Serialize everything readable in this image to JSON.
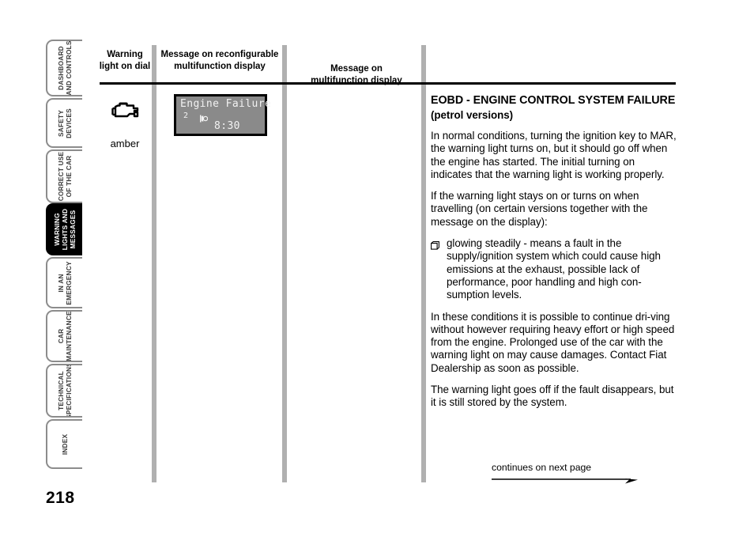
{
  "page": {
    "number": "218"
  },
  "sidebar": {
    "items": [
      {
        "label": "DASHBOARD\nAND CONTROLS",
        "active": false
      },
      {
        "label": "SAFETY\nDEVICES",
        "active": false
      },
      {
        "label": "CORRECT USE\nOF THE CAR",
        "active": false
      },
      {
        "label": "WARNING\nLIGHTS AND\nMESSAGES",
        "active": true
      },
      {
        "label": "IN AN\nEMERGENCY",
        "active": false
      },
      {
        "label": "CAR\nMAINTENANCE",
        "active": false
      },
      {
        "label": "TECHNICAL\nSPECIFICATIONS",
        "active": false
      },
      {
        "label": "INDEX",
        "active": false
      }
    ]
  },
  "table": {
    "headers": {
      "col1": "Warning\nlight on dial",
      "col2": "Message on reconfigurable\nmultifunction display",
      "col3": "Message on\nmultifunction display"
    },
    "warning_light": {
      "icon": "engine-check-icon",
      "color_label": "amber"
    },
    "lcd": {
      "message": "Engine Failure",
      "zone": "2",
      "zone_icon": "key-symbol",
      "time": "8:30",
      "background_color": "#8a8a8a",
      "text_color": "#f2f2f2"
    }
  },
  "content": {
    "title_main": "EOBD - ENGINE CONTROL SYSTEM FAILURE",
    "title_sub": " (petrol versions)",
    "paragraphs": [
      "In normal conditions, turning the ignition key to MAR, the warning light turns on, but it should go off when the engine has started. The initial turning on indicates that the warning light is working properly.",
      "If the warning light stays on or turns on when travelling (on certain versions together with the message on the display):"
    ],
    "bullet": {
      "marker": "square-bullet-icon",
      "text": "glowing steadily - means a fault in the supply/ignition system which could cause high emissions at the exhaust, possible lack of performance, poor handling and high con-sumption levels."
    },
    "paragraphs_after": [
      "In these conditions it is possible to continue dri-ving without however requiring heavy effort or high speed from the engine. Prolonged use of the car with the warning light on may cause damages. Contact Fiat Dealership as soon as possible.",
      "The warning light goes off if the fault disappears, but it is still stored by the system."
    ]
  },
  "footer": {
    "continues_label": "continues on next page"
  }
}
